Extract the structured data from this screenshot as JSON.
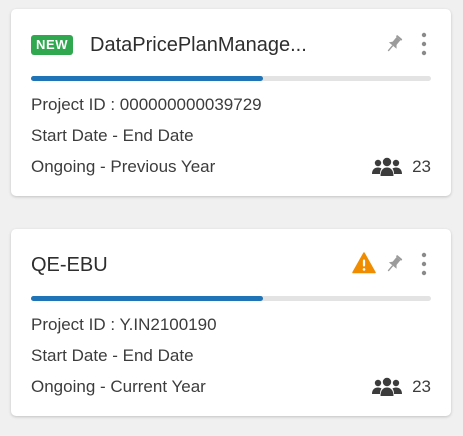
{
  "cards": [
    {
      "badge": "NEW",
      "title": "DataPricePlanManage...",
      "warning": false,
      "progress": 0.58,
      "project_id": "Project ID : 000000000039729",
      "dates": "Start Date - End Date",
      "status": "Ongoing - Previous Year",
      "member_count": "23"
    },
    {
      "badge": "",
      "title": "QE-EBU",
      "warning": true,
      "progress": 0.58,
      "project_id": "Project ID : Y.IN2100190",
      "dates": "Start Date - End Date",
      "status": "Ongoing - Current Year",
      "member_count": "23"
    }
  ],
  "icons": {
    "pin": "pin-icon",
    "more": "more-vertical-icon",
    "warning": "warning-icon",
    "members": "users-icon"
  },
  "colors": {
    "badge_new": "#2fa84f",
    "progress": "#1f73b7",
    "progress_track": "#e3e3e3",
    "warning": "#f08c00",
    "icon_gray": "#9b9b9b",
    "icon_dark": "#3c3c3c"
  }
}
